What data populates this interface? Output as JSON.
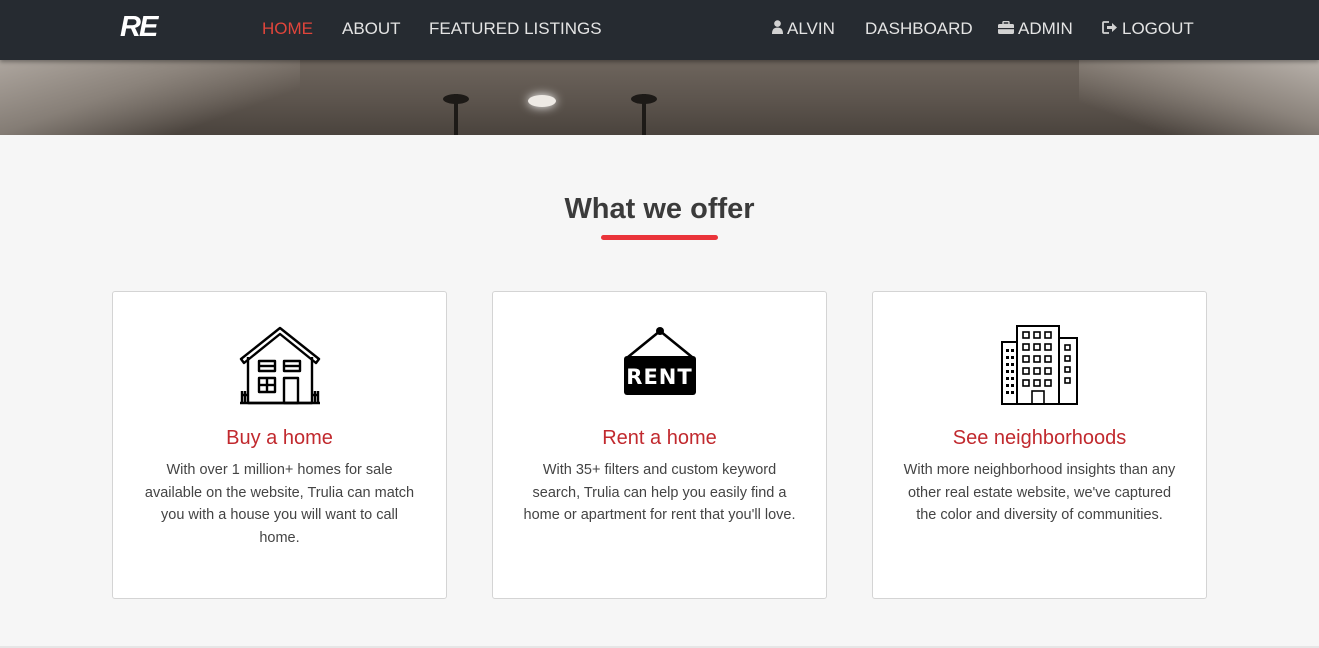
{
  "brand": {
    "logo_text": "RE"
  },
  "nav": {
    "left_items": [
      {
        "label": "HOME",
        "active": true
      },
      {
        "label": "ABOUT",
        "active": false
      },
      {
        "label": "FEATURED LISTINGS",
        "active": false
      }
    ],
    "right_items": [
      {
        "label": "ALVIN",
        "icon": "user-icon"
      },
      {
        "label": "DASHBOARD",
        "icon": ""
      },
      {
        "label": "ADMIN",
        "icon": "briefcase-icon"
      },
      {
        "label": "LOGOUT",
        "icon": "sign-out-icon"
      }
    ]
  },
  "offer": {
    "title": "What we offer",
    "cards": [
      {
        "icon": "house-icon",
        "title": "Buy a home",
        "text": "With over 1 million+ homes for sale available on the website, Trulia can match you with a house you will want to call home."
      },
      {
        "icon": "rent-sign-icon",
        "icon_text": "RENT",
        "title": "Rent a home",
        "text": "With 35+ filters and custom keyword search, Trulia can help you easily find a home or apartment for rent that you'll love."
      },
      {
        "icon": "buildings-icon",
        "title": "See neighborhoods",
        "text": "With more neighborhood insights than any other real estate website, we've captured the color and diversity of communities."
      }
    ]
  },
  "colors": {
    "navbar_bg": "#262b31",
    "accent_red": "#ea343a",
    "card_title_red": "#c1292e",
    "page_bg": "#f6f6f6"
  }
}
